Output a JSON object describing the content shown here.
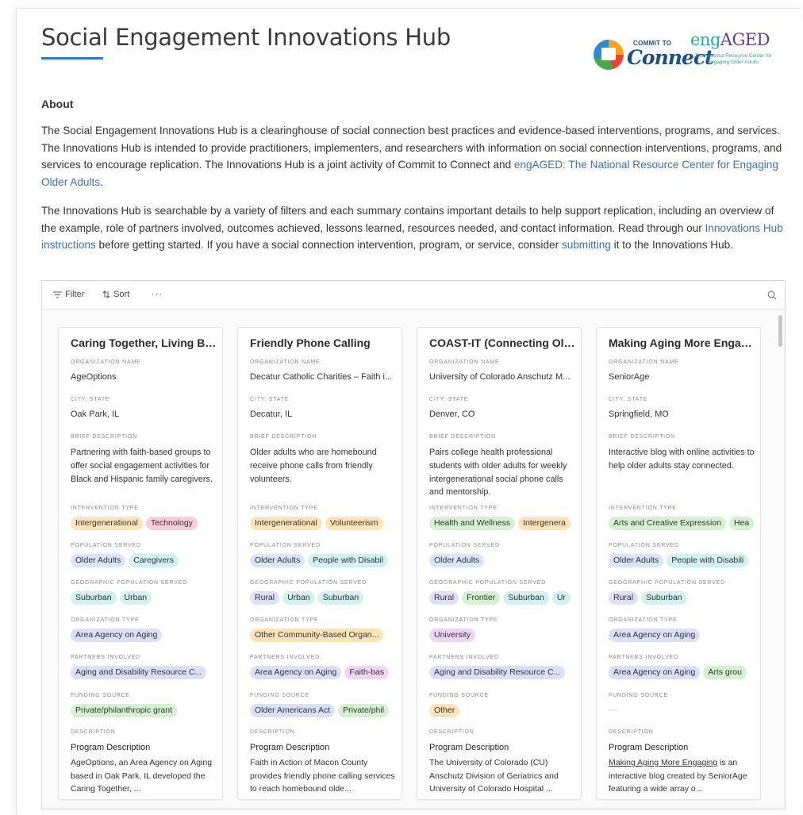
{
  "hub": {
    "title": "Social Engagement Innovations Hub"
  },
  "logos": {
    "commit_small": "COMMIT TO",
    "commit_big": "Connect",
    "engaged_eng": "eng",
    "engaged_aged": "AGED",
    "engaged_sub": "The National Resource Center for Engaging Older Adults"
  },
  "about": {
    "heading": "About",
    "p1_a": "The Social Engagement Innovations Hub is a clearinghouse of social connection best practices and evidence-based interventions, programs, and services. The Innovations Hub is intended to provide practitioners, implementers, and researchers with information on social connection interventions, programs, and services to encourage replication. The Innovations Hub is a joint activity of Commit to Connect and ",
    "p1_link": "engAGED: The National Resource Center for Engaging Older Adults",
    "p1_end": ".",
    "p2_a": "The Innovations Hub is searchable by a variety of filters and each summary contains important details to help support replication, including an overview of the example, role of partners involved, outcomes achieved, lessons learned, resources needed, and contact information. Read through our ",
    "p2_link1": "Innovations Hub instructions",
    "p2_b": " before getting started. If you have a social connection intervention, program, or service, consider ",
    "p2_link2": "submitting",
    "p2_c": " it to the Innovations Hub."
  },
  "toolbar": {
    "filter_label": "Filter",
    "sort_label": "Sort",
    "more_label": "···"
  },
  "field_labels": {
    "org": "ORGANIZATION NAME",
    "city": "CITY, STATE",
    "brief": "BRIEF DESCRIPTION",
    "intervention": "INTERVENTION TYPE",
    "population": "POPULATION SERVED",
    "geo": "GEOGRAPHIC POPULATION SERVED",
    "orgtype": "ORGANIZATION TYPE",
    "partners": "PARTNERS INVOLVED",
    "funding": "FUNDING SOURCE",
    "description": "DESCRIPTION"
  },
  "cards": [
    {
      "title": "Caring Together, Living Bet...",
      "org": "AgeOptions",
      "city": "Oak Park, IL",
      "brief": "Partnering with faith-based groups to offer social engagement activities for Black and Hispanic family caregivers.",
      "intervention": [
        "Intergenerational",
        "Technology"
      ],
      "population": [
        "Older Adults",
        "Caregivers"
      ],
      "geo": [
        "Suburban",
        "Urban"
      ],
      "orgtype": [
        "Area Agency on Aging"
      ],
      "partners": [
        "Aging and Disability Resource C..."
      ],
      "funding": [
        "Private/philanthropic grant"
      ],
      "desc_head": "Program Description",
      "desc_body": "AgeOptions, an Area Agency on Aging based in Oak Park, IL developed the Caring Together, ..."
    },
    {
      "title": "Friendly Phone Calling",
      "org": "Decatur Catholic Charities – Faith i...",
      "city": "Decatur, IL",
      "brief": "Older adults who are homebound receive phone calls from friendly volunteers.",
      "intervention": [
        "Intergenerational",
        "Volunteerism"
      ],
      "population": [
        "Older Adults",
        "People with Disabil"
      ],
      "geo": [
        "Rural",
        "Urban",
        "Suburban"
      ],
      "orgtype": [
        "Other Community-Based Organ..."
      ],
      "partners": [
        "Area Agency on Aging",
        "Faith-bas"
      ],
      "funding": [
        "Older Americans Act",
        "Private/phil"
      ],
      "desc_head": "Program Description",
      "desc_body": "Faith in Action of Macon County provides friendly phone calling services to reach homebound olde..."
    },
    {
      "title": "COAST-IT (Connecting Old...",
      "org": "University of Colorado Anschutz M...",
      "city": "Denver, CO",
      "brief": "Pairs college health professional students with older adults for weekly intergenerational social phone calls and mentorship.",
      "intervention": [
        "Health and Wellness",
        "Intergenera"
      ],
      "population": [
        "Older Adults"
      ],
      "geo": [
        "Rural",
        "Frontier",
        "Suburban",
        "Ur"
      ],
      "orgtype": [
        "University"
      ],
      "partners": [
        "Aging and Disability Resource C..."
      ],
      "funding": [
        "Other"
      ],
      "desc_head": "Program Description",
      "desc_body": "The University of Colorado (CU) Anschutz Division of Geriatrics and University of Colorado Hospital ..."
    },
    {
      "title": "Making Aging More Engag...",
      "org": "SeniorAge",
      "city": "Springfield, MO",
      "brief": "Interactive blog with online activities to help older adults stay connected.",
      "intervention": [
        "Arts and Creative Expression",
        "Hea"
      ],
      "population": [
        "Older Adults",
        "People with Disabili"
      ],
      "geo": [
        "Rural",
        "Suburban"
      ],
      "orgtype": [
        "Area Agency on Aging"
      ],
      "partners": [
        "Area Agency on Aging",
        "Arts grou"
      ],
      "funding_empty": "—",
      "desc_head": "Program Description",
      "desc_link": "Making Aging More Engaging",
      "desc_rest": " is an interactive blog created by SeniorAge featuring a wide array o..."
    }
  ],
  "pill_colors": {
    "Intergenerational": "#fde3b8",
    "Technology": "#f9cdd9",
    "Volunteerism": "#fde3b8",
    "Health and Wellness": "#d6f0d2",
    "Intergenera": "#fde3b8",
    "Arts and Creative Expression": "#d6f0d2",
    "Hea": "#d6f0d2",
    "Older Adults": "#d9e5fa",
    "Caregivers": "#d2f0ef",
    "People with Disabil": "#d2f0ef",
    "People with Disabili": "#d2f0ef",
    "Suburban": "#d2f0ef",
    "Urban": "#d2f0ef",
    "Rural": "#dcdff8",
    "Frontier": "#d6f0d2",
    "Ur": "#d2f0ef",
    "Area Agency on Aging": "#dcdff8",
    "Other Community-Based Organ...": "#fde3b8",
    "University": "#efd6f5",
    "Aging and Disability Resource C...": "#dcdff8",
    "Faith-bas": "#efd6f5",
    "Arts grou": "#d6f0d2",
    "Private/philanthropic grant": "#d6f0d2",
    "Older Americans Act": "#dcdff8",
    "Private/phil": "#d6f0d2",
    "Other": "#fde3b8"
  }
}
